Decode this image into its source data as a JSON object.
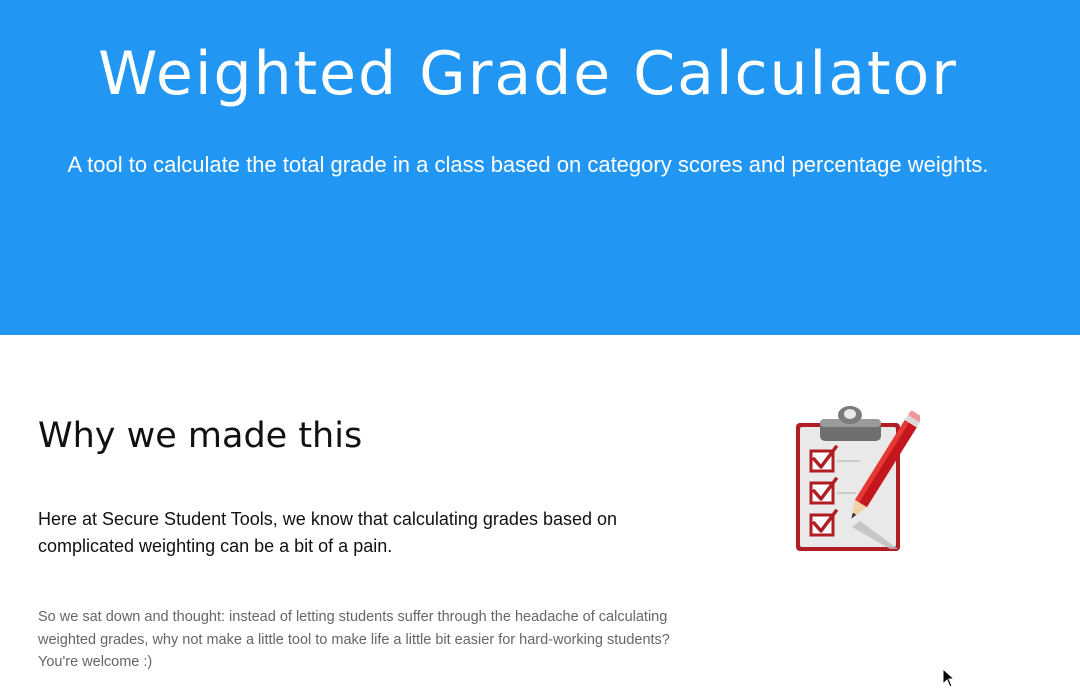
{
  "hero": {
    "title": "Weighted Grade Calculator",
    "subtitle": "A tool to calculate the total grade in a class based on category scores and percentage weights."
  },
  "about": {
    "heading": "Why we made this",
    "lead": "Here at Secure Student Tools, we know that calculating grades based on complicated weighting can be a bit of a pain.",
    "body_line_1": "So we sat down and thought: instead of letting students suffer through the headache of calculating",
    "body_line_2": "weighted grades, why not make a little tool to make life a little bit easier for hard-working students?",
    "body_line_3": "You're welcome :)"
  },
  "colors": {
    "hero_background": "#2196f3",
    "hero_text": "#ffffff",
    "clipboard_red": "#b01e23",
    "body_gray": "#666666"
  },
  "icons": {
    "illustration": "clipboard-checklist-icon",
    "pointer": "mouse-cursor-icon"
  }
}
